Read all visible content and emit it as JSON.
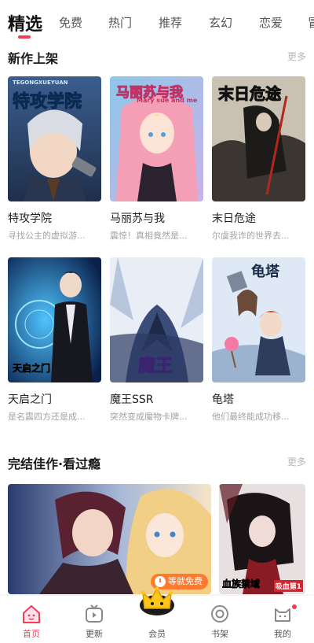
{
  "tabs": [
    "精选",
    "免费",
    "热门",
    "推荐",
    "玄幻",
    "恋爱",
    "冒"
  ],
  "sections": {
    "new_releases": {
      "title": "新作上架",
      "more": "更多"
    },
    "completed": {
      "title": "完结佳作·看过瘾",
      "more": "更多"
    }
  },
  "comics": [
    {
      "title": "特攻学院",
      "desc": "寻找公主的虚拟游...",
      "cover_text": "特攻学院",
      "cover_sub": "TEGONGXUEYUAN"
    },
    {
      "title": "马丽苏与我",
      "desc": "震惊！真相竟然是...",
      "cover_text": "马丽苏与我",
      "cover_sub": "Mary sue and me"
    },
    {
      "title": "末日危途",
      "desc": "尔虞我诈的世界去...",
      "cover_text": "末日危途"
    },
    {
      "title": "天启之门",
      "desc": "是名震四方还是成...",
      "cover_text": "天启之门"
    },
    {
      "title": "魔王SSR",
      "desc": "突然变成魔物卡牌...",
      "cover_text": "魔王"
    },
    {
      "title": "龟塔",
      "desc": "他们最终能成功移...",
      "cover_text": "龟塔"
    }
  ],
  "completed_banners": {
    "badge": "等就免费",
    "small_cover_text": "血族禁域",
    "small_cover_tag": "吸血第1"
  },
  "bottom_nav": [
    {
      "label": "首页",
      "icon": "home-icon"
    },
    {
      "label": "更新",
      "icon": "tv-icon"
    },
    {
      "label": "会员",
      "icon": "crown-icon"
    },
    {
      "label": "书架",
      "icon": "bookshelf-icon"
    },
    {
      "label": "我的",
      "icon": "cat-profile-icon"
    }
  ],
  "colors": {
    "accent": "#f23c5a",
    "badge": "#ff7a2d",
    "muted": "#a3a3a3"
  }
}
